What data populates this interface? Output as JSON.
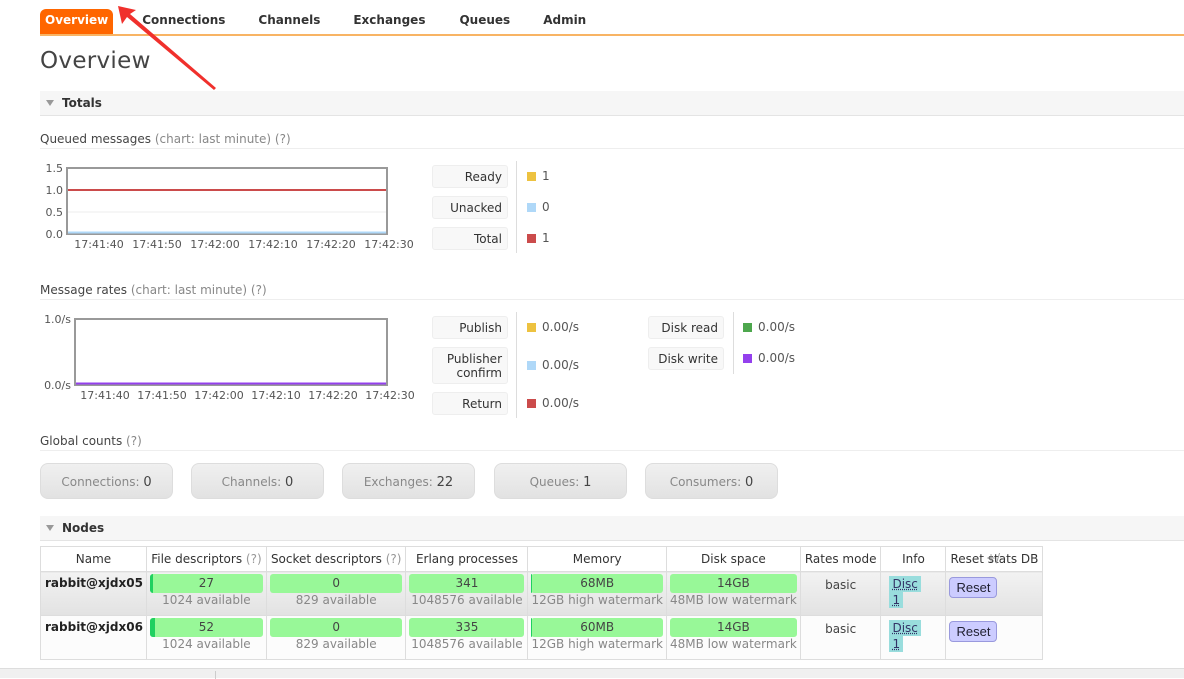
{
  "nav": {
    "tabs": [
      {
        "label": "Overview",
        "active": true
      },
      {
        "label": "Connections",
        "active": false
      },
      {
        "label": "Channels",
        "active": false
      },
      {
        "label": "Exchanges",
        "active": false
      },
      {
        "label": "Queues",
        "active": false
      },
      {
        "label": "Admin",
        "active": false
      }
    ]
  },
  "page_title": "Overview",
  "totals": {
    "section_label": "Totals",
    "queued": {
      "title": "Queued messages",
      "hint": "(chart: last minute) (?)",
      "legend": [
        {
          "label": "Ready",
          "value": "1",
          "color": "#edc240"
        },
        {
          "label": "Unacked",
          "value": "0",
          "color": "#afd8f8"
        },
        {
          "label": "Total",
          "value": "1",
          "color": "#cb4b4b"
        }
      ]
    },
    "rates": {
      "title": "Message rates",
      "hint": "(chart: last minute) (?)",
      "legend_left": [
        {
          "label": "Publish",
          "value": "0.00/s",
          "color": "#edc240"
        },
        {
          "label": "Publisher confirm",
          "value": "0.00/s",
          "color": "#afd8f8"
        },
        {
          "label": "Return",
          "value": "0.00/s",
          "color": "#cb4b4b"
        }
      ],
      "legend_right": [
        {
          "label": "Disk read",
          "value": "0.00/s",
          "color": "#4da74d"
        },
        {
          "label": "Disk write",
          "value": "0.00/s",
          "color": "#9440ed"
        }
      ]
    },
    "global": {
      "title": "Global counts",
      "hint": "(?)",
      "counts": [
        {
          "label": "Connections:",
          "value": "0"
        },
        {
          "label": "Channels:",
          "value": "0"
        },
        {
          "label": "Exchanges:",
          "value": "22"
        },
        {
          "label": "Queues:",
          "value": "1"
        },
        {
          "label": "Consumers:",
          "value": "0"
        }
      ]
    }
  },
  "chart_data": [
    {
      "type": "line",
      "title": "Queued messages",
      "x": [
        "17:41:40",
        "17:41:50",
        "17:42:00",
        "17:42:10",
        "17:42:20",
        "17:42:30"
      ],
      "yticks": [
        "1.5",
        "1.0",
        "0.5",
        "0.0"
      ],
      "ylim": [
        0,
        1.5
      ],
      "grid": true,
      "series": [
        {
          "name": "Ready",
          "color": "#edc240",
          "values": [
            1,
            1,
            1,
            1,
            1,
            1
          ]
        },
        {
          "name": "Unacked",
          "color": "#afd8f8",
          "values": [
            0,
            0,
            0,
            0,
            0,
            0
          ]
        },
        {
          "name": "Total",
          "color": "#cb4b4b",
          "values": [
            1,
            1,
            1,
            1,
            1,
            1
          ]
        }
      ]
    },
    {
      "type": "line",
      "title": "Message rates",
      "x": [
        "17:41:40",
        "17:41:50",
        "17:42:00",
        "17:42:10",
        "17:42:20",
        "17:42:30"
      ],
      "yticks": [
        "1.0/s",
        "0.0/s"
      ],
      "ylim": [
        0,
        1
      ],
      "grid": false,
      "series": [
        {
          "name": "Publish",
          "color": "#edc240",
          "values": [
            0,
            0,
            0,
            0,
            0,
            0
          ]
        },
        {
          "name": "Publisher confirm",
          "color": "#afd8f8",
          "values": [
            0,
            0,
            0,
            0,
            0,
            0
          ]
        },
        {
          "name": "Return",
          "color": "#cb4b4b",
          "values": [
            0,
            0,
            0,
            0,
            0,
            0
          ]
        },
        {
          "name": "Disk read",
          "color": "#4da74d",
          "values": [
            0,
            0,
            0,
            0,
            0,
            0
          ]
        },
        {
          "name": "Disk write",
          "color": "#9440ed",
          "values": [
            0,
            0,
            0,
            0,
            0,
            0
          ]
        }
      ]
    }
  ],
  "nodes": {
    "section_label": "Nodes",
    "columns": {
      "name": "Name",
      "fd": "File descriptors",
      "sd": "Socket descriptors",
      "q": "(?)",
      "erl": "Erlang processes",
      "mem": "Memory",
      "disk": "Disk space",
      "rates": "Rates mode",
      "info": "Info",
      "reset": "Reset stats DB"
    },
    "plus_minus": "+/-",
    "rows": [
      {
        "name": "rabbit@xjdx05",
        "fd": "27",
        "fd_avail": "1024 available",
        "fd_fraction": 0.026,
        "sd": "0",
        "sd_avail": "829 available",
        "erl": "341",
        "erl_avail": "1048576 available",
        "mem": "68MB",
        "mem_avail": "12GB high watermark",
        "disk": "14GB",
        "disk_avail": "48MB low watermark",
        "rates_mode": "basic",
        "info_disc": "Disc",
        "info_num": "1",
        "reset_label": "Reset"
      },
      {
        "name": "rabbit@xjdx06",
        "fd": "52",
        "fd_avail": "1024 available",
        "fd_fraction": 0.051,
        "sd": "0",
        "sd_avail": "829 available",
        "erl": "335",
        "erl_avail": "1048576 available",
        "mem": "60MB",
        "mem_avail": "12GB high watermark",
        "disk": "14GB",
        "disk_avail": "48MB low watermark",
        "rates_mode": "basic",
        "info_disc": "Disc",
        "info_num": "1",
        "reset_label": "Reset"
      }
    ]
  }
}
